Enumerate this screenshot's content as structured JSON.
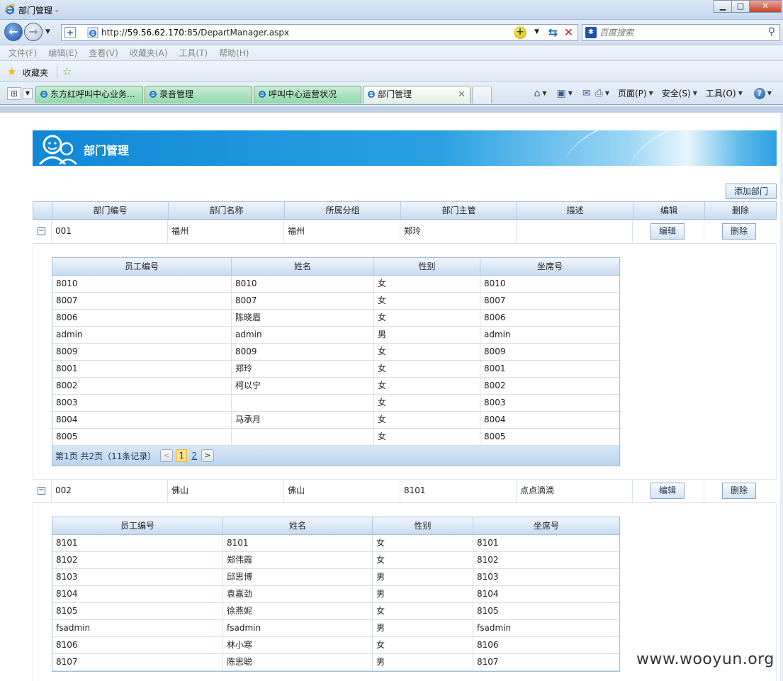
{
  "window": {
    "title": "部门管理 -"
  },
  "address": {
    "url_prefix": "http://",
    "url_host": "59.56.62.170",
    "url_rest": ":85/DepartManager.aspx"
  },
  "search": {
    "placeholder": "百度搜索"
  },
  "menu": [
    "文件(F)",
    "编辑(E)",
    "查看(V)",
    "收藏夹(A)",
    "工具(T)",
    "帮助(H)"
  ],
  "favorites": {
    "label": "收藏夹"
  },
  "tabs": [
    {
      "label": "东方红呼叫中心业务..."
    },
    {
      "label": "录音管理"
    },
    {
      "label": "呼叫中心运营状况"
    },
    {
      "label": "部门管理"
    }
  ],
  "commands": {
    "page": "页面(P)",
    "safety": "安全(S)",
    "tools": "工具(O)"
  },
  "page": {
    "title": "部门管理",
    "add_button": "添加部门"
  },
  "dept_headers": [
    "部门编号",
    "部门名称",
    "所属分组",
    "部门主管",
    "描述",
    "编辑",
    "删除"
  ],
  "emp_headers": [
    "员工编号",
    "姓名",
    "性别",
    "坐席号"
  ],
  "edit_label": "编辑",
  "delete_label": "删除",
  "departments": [
    {
      "id": "001",
      "name": "福州",
      "group": "福州",
      "manager": "郑玲",
      "desc": "",
      "employees": [
        [
          "8010",
          "8010",
          "女",
          "8010"
        ],
        [
          "8007",
          "8007",
          "女",
          "8007"
        ],
        [
          "8006",
          "陈晓眉",
          "女",
          "8006"
        ],
        [
          "admin",
          "admin",
          "男",
          "admin"
        ],
        [
          "8009",
          "8009",
          "女",
          "8009"
        ],
        [
          "8001",
          "郑玲",
          "女",
          "8001"
        ],
        [
          "8002",
          "柯以宁",
          "女",
          "8002"
        ],
        [
          "8003",
          "",
          "女",
          "8003"
        ],
        [
          "8004",
          "马承月",
          "女",
          "8004"
        ],
        [
          "8005",
          "",
          "女",
          "8005"
        ]
      ],
      "pager": {
        "info": "第1页 共2页（11条记录）",
        "current": "1",
        "next": "2"
      }
    },
    {
      "id": "002",
      "name": "佛山",
      "group": "佛山",
      "manager": "8101",
      "desc": "点点滴滴",
      "employees": [
        [
          "8101",
          "8101",
          "女",
          "8101"
        ],
        [
          "8102",
          "郑伟霞",
          "女",
          "8102"
        ],
        [
          "8103",
          "邱思博",
          "男",
          "8103"
        ],
        [
          "8104",
          "袁嘉劲",
          "男",
          "8104"
        ],
        [
          "8105",
          "徐燕妮",
          "女",
          "8105"
        ],
        [
          "fsadmin",
          "fsadmin",
          "男",
          "fsadmin"
        ],
        [
          "8106",
          "林小寒",
          "女",
          "8106"
        ],
        [
          "8107",
          "陈思聪",
          "男",
          "8107"
        ]
      ]
    }
  ],
  "watermark": "www.wooyun.org"
}
